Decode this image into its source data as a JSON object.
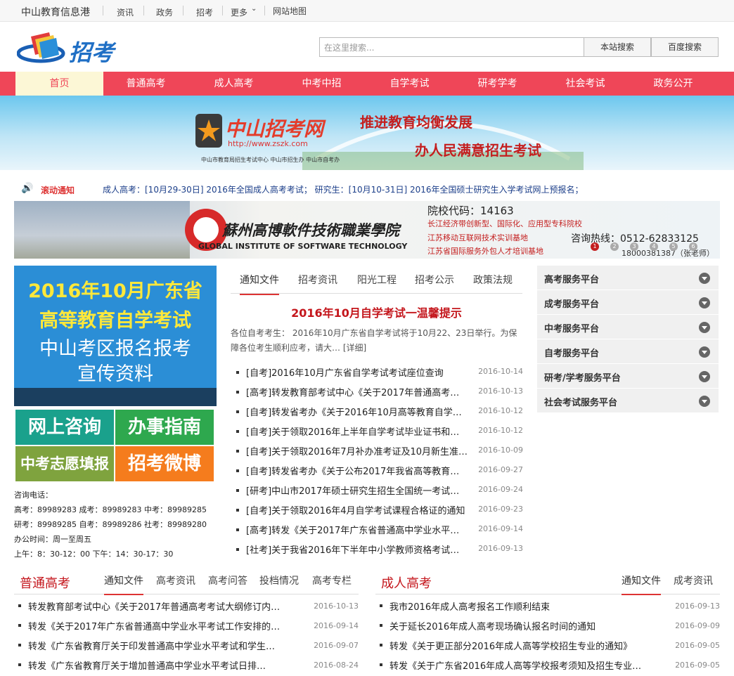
{
  "topbar": {
    "site": "中山教育信息港",
    "links": [
      "资讯",
      "政务",
      "招考",
      "更多",
      "网站地图"
    ]
  },
  "header": {
    "logo_text": "招考",
    "search_placeholder": "在这里搜索...",
    "btn_site": "本站搜索",
    "btn_baidu": "百度搜索"
  },
  "nav": [
    "首页",
    "普通高考",
    "成人高考",
    "中考中招",
    "自学考试",
    "研考学考",
    "社会考试",
    "政务公开"
  ],
  "banner": {
    "brand": "中山招考网",
    "url": "http://www.zszk.com",
    "slogan1": "推进教育均衡发展",
    "slogan2": "办人民满意招生考试",
    "sub": "中山市教育局招生考试中心 中山市招生办 中山市自考办"
  },
  "notice": {
    "label": "滚动通知",
    "text": "成人高考：[10月29-30日] 2016年全国成人高考考试；  研究生：[10月10-31日] 2016年全国硕士研究生入学考试网上预报名；"
  },
  "ad": {
    "school": "蘇州高博軟件技術職業學院",
    "english": "GLOBAL INSTITUTE OF SOFTWARE TECHNOLOGY",
    "code": "院校代码：14163",
    "l1": "长江经济带创新型、国际化、应用型专科院校",
    "l2": "江苏移动互联网技术实训基地",
    "l3": "江苏省国际服务外包人才培训基地",
    "hotline": "咨询热线：0512-62833125",
    "mobile": "18000381387（张老师）",
    "dots": [
      "1",
      "2",
      "3",
      "4",
      "5",
      "6"
    ]
  },
  "promo": {
    "l1": "2016年10月广东省",
    "l2": "高等教育自学考试",
    "l3": "中山考区报名报考",
    "l4": "宣传资料"
  },
  "tiles": [
    "网上咨询",
    "办事指南",
    "中考志愿填报",
    "招考微博"
  ],
  "contact": {
    "title": "咨询电话：",
    "l1": "高考：89989283  成考：89989283  中考：89989285",
    "l2": "研考：89989285  自考：89989286  社考：89989280",
    "l3": "办公时间：周一至周五",
    "l4": "上午：8：30-12：00    下午：14：30-17：30"
  },
  "tabs": [
    "通知文件",
    "招考资讯",
    "阳光工程",
    "招考公示",
    "政策法规"
  ],
  "headline": "2016年10月自学考试一温馨提示",
  "summary": "      各位自考考生：        2016年10月广东省自学考试将于10月22、23日举行。为保障各位考生顺利应考，请大… [详细]",
  "news": [
    {
      "t": "[自考]2016年10月广东省自学考试考试座位查询",
      "d": "2016-10-14"
    },
    {
      "t": "[高考]转发教育部考试中心《关于2017年普通高考…",
      "d": "2016-10-13"
    },
    {
      "t": "[自考]转发省考办《关于2016年10月高等教育自学…",
      "d": "2016-10-12"
    },
    {
      "t": "[自考]关于领取2016年上半年自学考试毕业证书和…",
      "d": "2016-10-12"
    },
    {
      "t": "[自考]关于领取2016年7月补办准考证及10月新生准…",
      "d": "2016-10-09"
    },
    {
      "t": "[自考]转发省考办《关于公布2017年我省高等教育…",
      "d": "2016-09-27"
    },
    {
      "t": "[研考]中山市2017年硕士研究生招生全国统一考试…",
      "d": "2016-09-24"
    },
    {
      "t": "[自考]关于领取2016年4月自学考试课程合格证的通知",
      "d": "2016-09-23"
    },
    {
      "t": "[高考]转发《关于2017年广东省普通高中学业水平…",
      "d": "2016-09-14"
    },
    {
      "t": "[社考]关于我省2016年下半年中小学教师资格考试…",
      "d": "2016-09-13"
    }
  ],
  "side": [
    "高考服务平台",
    "成考服务平台",
    "中考服务平台",
    "自考服务平台",
    "研考/学考服务平台",
    "社会考试服务平台"
  ],
  "sec1": {
    "title": "普通高考",
    "tabs": [
      "通知文件",
      "高考资讯",
      "高考问答",
      "投档情况",
      "高考专栏"
    ],
    "rows": [
      {
        "t": "转发教育部考试中心《关于2017年普通高考考试大纲修订内…",
        "d": "2016-10-13"
      },
      {
        "t": "转发《关于2017年广东省普通高中学业水平考试工作安排的…",
        "d": "2016-09-14"
      },
      {
        "t": "转发《广东省教育厅关于印发普通高中学业水平考试和学生…",
        "d": "2016-09-07"
      },
      {
        "t": "转发《广东省教育厅关于增加普通高中学业水平考试日排…",
        "d": "2016-08-24"
      }
    ]
  },
  "sec2": {
    "title": "成人高考",
    "tabs": [
      "通知文件",
      "成考资讯"
    ],
    "rows": [
      {
        "t": "我市2016年成人高考报名工作顺利结束",
        "d": "2016-09-13"
      },
      {
        "t": "关于延长2016年成人高考现场确认报名时间的通知",
        "d": "2016-09-09"
      },
      {
        "t": "转发《关于更正部分2016年成人高等学校招生专业的通知》",
        "d": "2016-09-05"
      },
      {
        "t": "转发《关于广东省2016年成人高等学校报考须知及招生专业…",
        "d": "2016-09-05"
      }
    ]
  }
}
